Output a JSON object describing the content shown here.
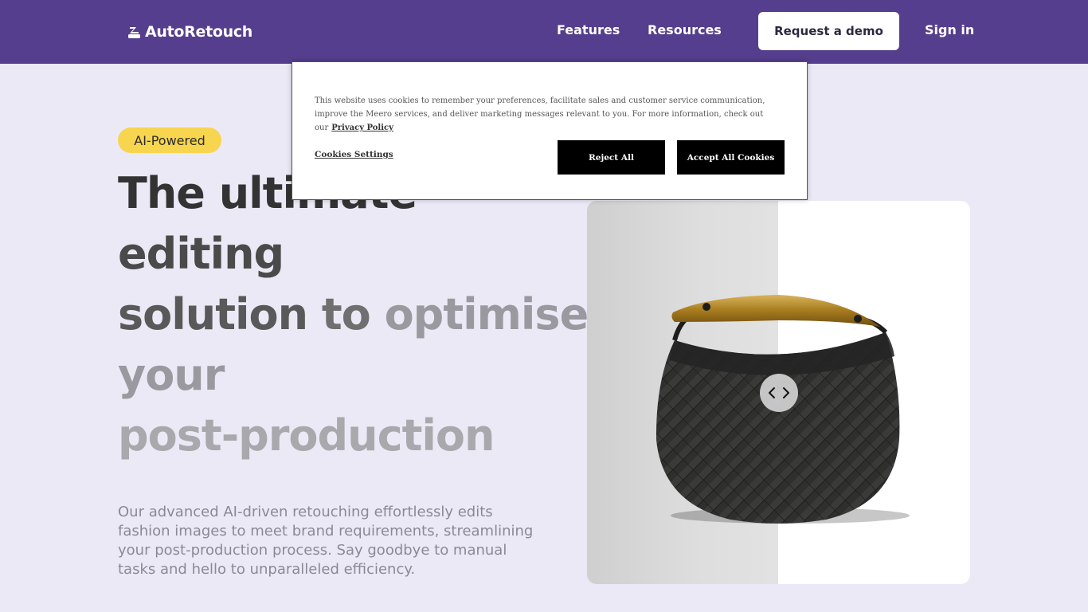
{
  "nav": {
    "logo_text": "AutoRetouch",
    "logo_icon": "autoretouch-logo-icon",
    "links": [
      "Features",
      "Resources"
    ],
    "demo_button": "Request a demo",
    "signin": "Sign in",
    "bar_color": "#553e8d"
  },
  "hero": {
    "badge": "AI-Powered",
    "headline": {
      "line1a": "The ultimate",
      "line2": "editing",
      "line3a": "solution",
      "line3b": " to ",
      "line3c": "optimise",
      "line4": "your",
      "line5": "post-production"
    },
    "description": "Our advanced AI-driven retouching effortlessly edits fashion images to meet brand requirements, streamlining your post-production process. Say goodbye to manual tasks and hello to unparalleled efficiency.",
    "compare_image": "black woven handbag with gold handle, before/after comparison",
    "slider_icon": "chevron-left-right-icon",
    "slider_position": 0.5
  },
  "cookie_banner": {
    "text": "This website uses cookies to remember your preferences, facilitate sales and customer service communication, improve the Meero services, and deliver marketing messages relevant to you. For more information, check out our",
    "privacy_link": "Privacy Policy",
    "settings": "Cookies Settings",
    "reject": "Reject All",
    "accept": "Accept All Cookies"
  },
  "colors": {
    "background": "#ece9f6",
    "badge": "#f7d54f",
    "cookie_button": "#000000"
  }
}
